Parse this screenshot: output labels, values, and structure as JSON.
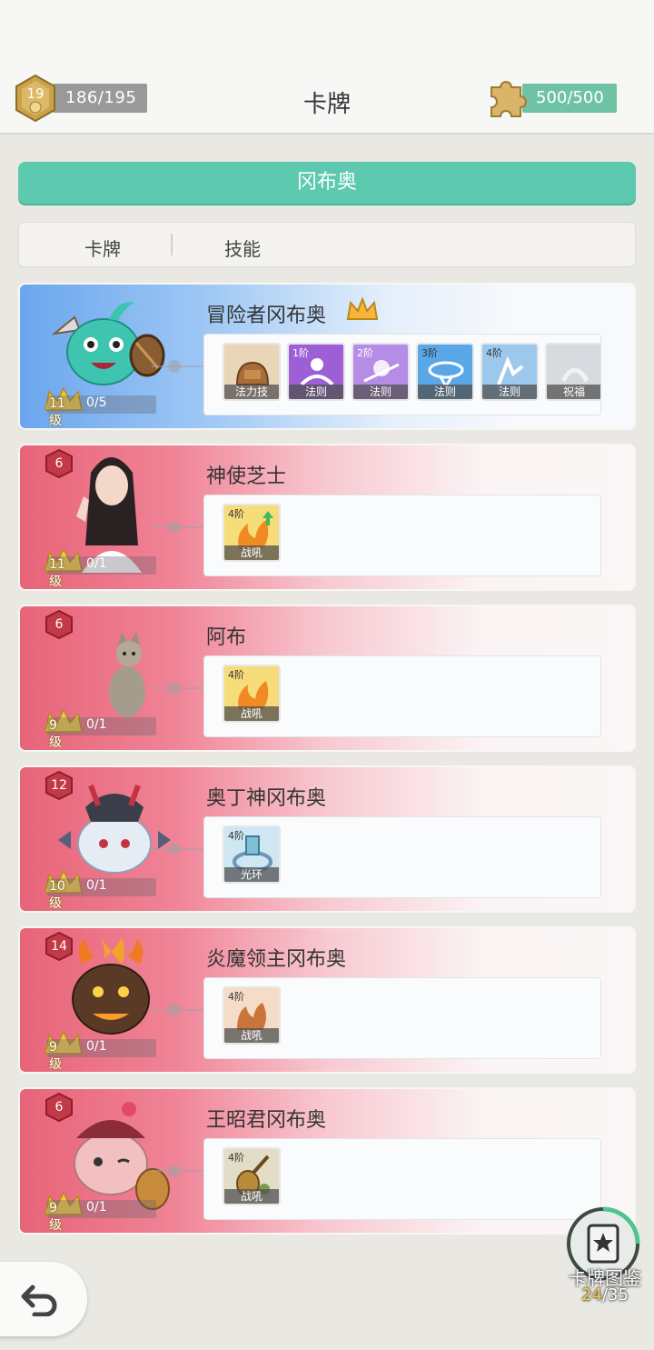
{
  "header": {
    "title": "卡牌",
    "player_level": "19",
    "exp": "186/195",
    "puzzle": "500/500"
  },
  "group_title": "冈布奥",
  "tabs": [
    "卡牌",
    "技能"
  ],
  "cards": [
    {
      "name": "冒险者冈布奥",
      "theme": "blue",
      "level": "11级",
      "progress": "0/5",
      "rank": null,
      "skills": [
        {
          "tier": "",
          "label": "法力技",
          "icon": "backpack-icon"
        },
        {
          "tier": "1阶",
          "label": "法则",
          "icon": "law-icon"
        },
        {
          "tier": "2阶",
          "label": "法则",
          "icon": "law-icon"
        },
        {
          "tier": "3阶",
          "label": "法则",
          "icon": "law-icon"
        },
        {
          "tier": "4阶",
          "label": "法则",
          "icon": "law-icon"
        },
        {
          "tier": "",
          "label": "祝福",
          "icon": "blessing-icon"
        }
      ]
    },
    {
      "name": "神使芝士",
      "theme": "pink",
      "level": "11级",
      "progress": "0/1",
      "rank": "6",
      "skills": [
        {
          "tier": "4阶",
          "label": "战吼",
          "icon": "flame-icon"
        }
      ]
    },
    {
      "name": "阿布",
      "theme": "pink",
      "level": "9级",
      "progress": "0/1",
      "rank": "6",
      "skills": [
        {
          "tier": "4阶",
          "label": "战吼",
          "icon": "flame-icon"
        }
      ]
    },
    {
      "name": "奥丁神冈布奥",
      "theme": "pink",
      "level": "10级",
      "progress": "0/1",
      "rank": "12",
      "skills": [
        {
          "tier": "4阶",
          "label": "光环",
          "icon": "aura-icon"
        }
      ]
    },
    {
      "name": "炎魔领主冈布奥",
      "theme": "pink",
      "level": "9级",
      "progress": "0/1",
      "rank": "14",
      "skills": [
        {
          "tier": "4阶",
          "label": "战吼",
          "icon": "fire-beast-icon"
        }
      ]
    },
    {
      "name": "王昭君冈布奥",
      "theme": "pink",
      "level": "9级",
      "progress": "0/1",
      "rank": "6",
      "skills": [
        {
          "tier": "4阶",
          "label": "战吼",
          "icon": "lute-icon"
        }
      ]
    }
  ],
  "collection": {
    "label": "卡牌图鉴",
    "owned": "24",
    "total": "/35"
  },
  "colors": {
    "accent_green": "#5dc9ae",
    "card_blue": "#6ba6ee",
    "card_pink": "#e86478",
    "rank_hex": "#c23a48"
  }
}
